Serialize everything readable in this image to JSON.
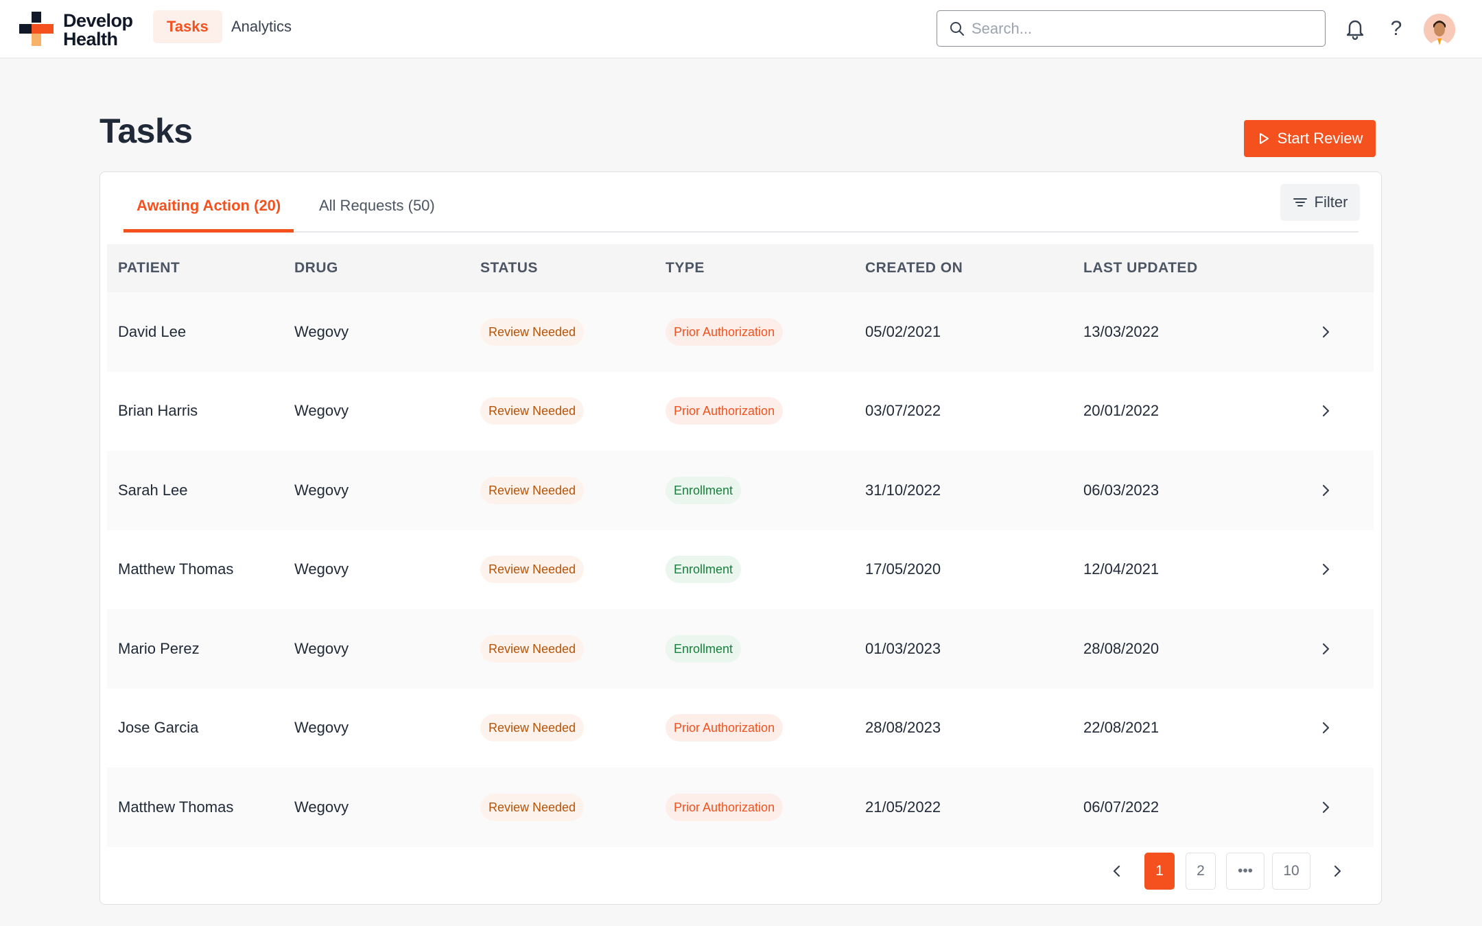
{
  "brand": {
    "name_line1": "Develop",
    "name_line2": "Health"
  },
  "nav": {
    "tabs": [
      {
        "label": "Tasks"
      },
      {
        "label": "Analytics"
      }
    ]
  },
  "search": {
    "placeholder": "Search..."
  },
  "header_icons": [
    "bell-icon",
    "help-icon",
    "avatar"
  ],
  "page": {
    "title": "Tasks",
    "start_review_label": "Start Review"
  },
  "tabs": [
    {
      "label": "Awaiting Action (20)",
      "active": true
    },
    {
      "label": "All Requests (50)",
      "active": false
    }
  ],
  "filter_label": "Filter",
  "table": {
    "columns": [
      "PATIENT",
      "DRUG",
      "STATUS",
      "TYPE",
      "CREATED ON",
      "LAST UPDATED"
    ],
    "rows": [
      {
        "patient": "David Lee",
        "drug": "Wegovy",
        "status": "Review Needed",
        "type": "Prior Authorization",
        "created": "05/02/2021",
        "updated": "13/03/2022"
      },
      {
        "patient": "Brian Harris",
        "drug": "Wegovy",
        "status": "Review Needed",
        "type": "Prior Authorization",
        "created": "03/07/2022",
        "updated": "20/01/2022"
      },
      {
        "patient": "Sarah Lee",
        "drug": "Wegovy",
        "status": "Review Needed",
        "type": "Enrollment",
        "created": "31/10/2022",
        "updated": "06/03/2023"
      },
      {
        "patient": "Matthew Thomas",
        "drug": "Wegovy",
        "status": "Review Needed",
        "type": "Enrollment",
        "created": "17/05/2020",
        "updated": "12/04/2021"
      },
      {
        "patient": "Mario Perez",
        "drug": "Wegovy",
        "status": "Review Needed",
        "type": "Enrollment",
        "created": "01/03/2023",
        "updated": "28/08/2020"
      },
      {
        "patient": "Jose Garcia",
        "drug": "Wegovy",
        "status": "Review Needed",
        "type": "Prior Authorization",
        "created": "28/08/2023",
        "updated": "22/08/2021"
      },
      {
        "patient": "Matthew Thomas",
        "drug": "Wegovy",
        "status": "Review Needed",
        "type": "Prior Authorization",
        "created": "21/05/2022",
        "updated": "06/07/2022"
      }
    ]
  },
  "pagination": {
    "pages": [
      "1",
      "2",
      "•••",
      "10"
    ],
    "current": "1"
  },
  "colors": {
    "accent": "#f4511e",
    "enrollment": "#16803c",
    "review": "#b45309"
  }
}
